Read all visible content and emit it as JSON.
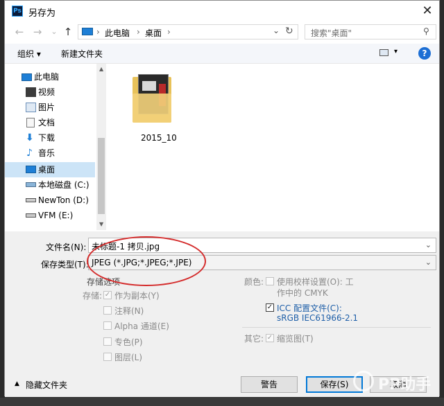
{
  "window": {
    "title": "另存为",
    "app_icon_text": "Ps"
  },
  "nav": {
    "back": "←",
    "forward": "→",
    "up": "↑",
    "chevron": "⌄",
    "refresh": "↻"
  },
  "address": {
    "crumbs": [
      "此电脑",
      "桌面"
    ],
    "separator": "›",
    "dropdown": "⌄"
  },
  "search": {
    "placeholder": "搜索\"桌面\"",
    "icon": "⚲"
  },
  "toolbar": {
    "organize": "组织 ▾",
    "new_folder": "新建文件夹",
    "view": "▾",
    "help": "?"
  },
  "sidebar": {
    "items": [
      {
        "label": "此电脑",
        "icon": "computer-icon"
      },
      {
        "label": "视频",
        "icon": "video-icon"
      },
      {
        "label": "图片",
        "icon": "pictures-icon"
      },
      {
        "label": "文档",
        "icon": "documents-icon"
      },
      {
        "label": "下载",
        "icon": "download-icon"
      },
      {
        "label": "音乐",
        "icon": "music-icon"
      },
      {
        "label": "桌面",
        "icon": "desktop-icon",
        "selected": true
      },
      {
        "label": "本地磁盘 (C:)",
        "icon": "drive-icon"
      },
      {
        "label": "NewTon (D:)",
        "icon": "drive-icon"
      },
      {
        "label": "VFM (E:)",
        "icon": "drive-icon"
      }
    ]
  },
  "files": [
    {
      "name": "2015_10",
      "type": "folder"
    }
  ],
  "form": {
    "filename_label": "文件名(N):",
    "filename_value": "未标题-1 拷贝.jpg",
    "filetype_label": "保存类型(T):",
    "filetype_value": "JPEG (*.JPG;*.JPEG;*.JPE)"
  },
  "options": {
    "title": "存储选项",
    "save_label": "存储:",
    "save_items": [
      {
        "label": "作为副本(Y)",
        "checked": true
      },
      {
        "label": "注释(N)",
        "checked": false
      },
      {
        "label": "Alpha 通道(E)",
        "checked": false
      },
      {
        "label": "专色(P)",
        "checked": false
      },
      {
        "label": "图层(L)",
        "checked": false
      }
    ],
    "color_label": "颜色:",
    "proof_line1": "使用校样设置(O):  工",
    "proof_line2": "作中的 CMYK",
    "icc_line1": "ICC 配置文件(C):",
    "icc_line2": "sRGB IEC61966-2.1",
    "other_label": "其它:",
    "thumbnail": "缩览图(T)"
  },
  "footer": {
    "hide_folders": "隐藏文件夹",
    "warning": "警告",
    "save": "保存(S)",
    "cancel": "取消"
  },
  "watermark": "PP助手",
  "colors": {
    "accent": "#0078d7",
    "selection": "#cce4f7",
    "annotation": "#d42a2a"
  }
}
